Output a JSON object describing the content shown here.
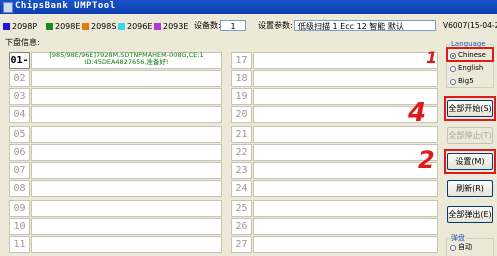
{
  "window": {
    "title": "ChipsBank UMPTool"
  },
  "legend": [
    {
      "label": "2098P",
      "color": "#1b1bd6"
    },
    {
      "label": "2098E",
      "color": "#1a8a1a"
    },
    {
      "label": "2098S",
      "color": "#e07a10"
    },
    {
      "label": "2096E",
      "color": "#37d6e8"
    },
    {
      "label": "2093E",
      "color": "#b03ad8"
    }
  ],
  "device_count": {
    "label": "设备数:",
    "value": "1"
  },
  "settings_param": {
    "label": "设置参数:",
    "value": "低级扫描 1 Ecc 12 智能 默认"
  },
  "version": "V6007(15-04-28",
  "panel_title": "下盘信息:",
  "slots": [
    {
      "num": "01-1",
      "text": "[985/98E/96E]7928M,SDTNPMAHEM-008G,CE:1\nID:45DEA4827656,准备好!"
    },
    {
      "num": "02",
      "text": ""
    },
    {
      "num": "03",
      "text": ""
    },
    {
      "num": "04",
      "text": ""
    },
    {
      "num": "05",
      "text": ""
    },
    {
      "num": "06",
      "text": ""
    },
    {
      "num": "07",
      "text": ""
    },
    {
      "num": "08",
      "text": ""
    },
    {
      "num": "09",
      "text": ""
    },
    {
      "num": "10",
      "text": ""
    },
    {
      "num": "11",
      "text": ""
    },
    {
      "num": "17",
      "text": ""
    },
    {
      "num": "18",
      "text": ""
    },
    {
      "num": "19",
      "text": ""
    },
    {
      "num": "20",
      "text": ""
    },
    {
      "num": "21",
      "text": ""
    },
    {
      "num": "22",
      "text": ""
    },
    {
      "num": "23",
      "text": ""
    },
    {
      "num": "24",
      "text": ""
    },
    {
      "num": "25",
      "text": ""
    },
    {
      "num": "26",
      "text": ""
    },
    {
      "num": "27",
      "text": ""
    }
  ],
  "language": {
    "title": "Language",
    "options": [
      "Chinese",
      "English",
      "Big5"
    ],
    "selected": "Chinese"
  },
  "buttons": {
    "start_all": "全部开始(S)",
    "stop_all": "全部停止(T)",
    "settings": "设置(M)",
    "refresh": "刷新(R)",
    "eject_all": "全部弹出(E)"
  },
  "eject_group": {
    "title": "弹盘",
    "option": "自动"
  },
  "annotations": {
    "n1": "1",
    "n2": "2",
    "n4": "4"
  }
}
